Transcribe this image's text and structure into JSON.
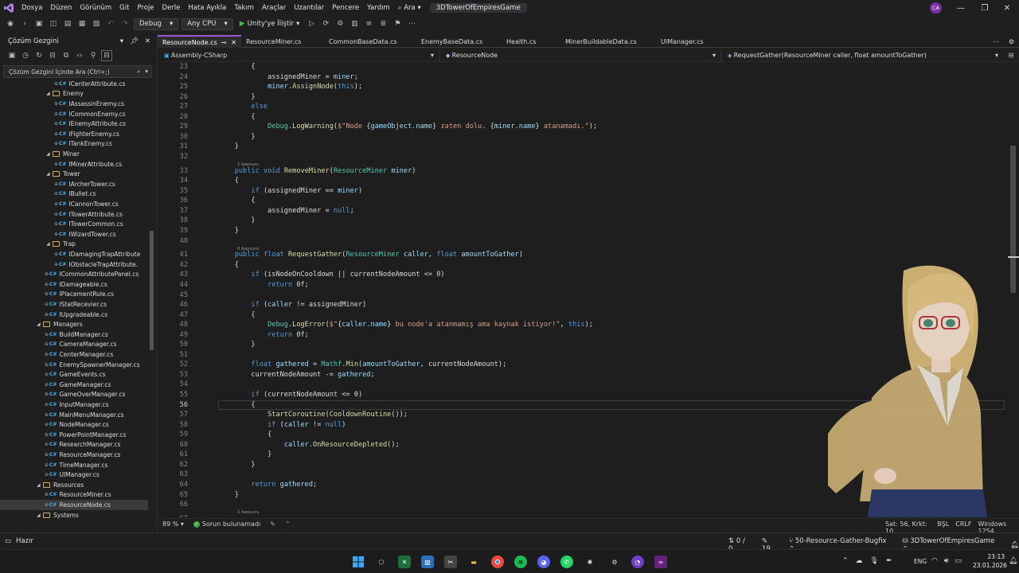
{
  "titlebar": {
    "menus": [
      "Dosya",
      "Düzen",
      "Görünüm",
      "Git",
      "Proje",
      "Derle",
      "Hata Ayıkla",
      "Takım",
      "Araçlar",
      "Uzantılar",
      "Pencere",
      "Yardım",
      "Ara"
    ],
    "solution": "3DTowerOfEmpiresGame",
    "avatar": "CA"
  },
  "toolbar": {
    "config": "Debug",
    "platform": "Any CPU",
    "run_label": "Unity'ye İliştir"
  },
  "solution_explorer": {
    "title": "Çözüm Gezgini",
    "search_placeholder": "Çözüm Gezgini İçinde Ara (Ctrl+;)",
    "tree": [
      {
        "label": "ICenterAttribute.cs",
        "type": "file",
        "indent": 5
      },
      {
        "label": "Enemy",
        "type": "folder",
        "indent": 4
      },
      {
        "label": "IAssassinEnemy.cs",
        "type": "file",
        "indent": 5
      },
      {
        "label": "ICommonEnemy.cs",
        "type": "file",
        "indent": 5
      },
      {
        "label": "IEnemyAttribute.cs",
        "type": "file",
        "indent": 5
      },
      {
        "label": "IFighterEnemy.cs",
        "type": "file",
        "indent": 5
      },
      {
        "label": "ITankEnemy.cs",
        "type": "file",
        "indent": 5
      },
      {
        "label": "Miner",
        "type": "folder",
        "indent": 4
      },
      {
        "label": "IMinerAttribute.cs",
        "type": "file",
        "indent": 5
      },
      {
        "label": "Tower",
        "type": "folder",
        "indent": 4
      },
      {
        "label": "IArcherTower.cs",
        "type": "file",
        "indent": 5
      },
      {
        "label": "IBullet.cs",
        "type": "file",
        "indent": 5
      },
      {
        "label": "ICannonTower.cs",
        "type": "file",
        "indent": 5
      },
      {
        "label": "ITowerAttribute.cs",
        "type": "file",
        "indent": 5
      },
      {
        "label": "ITowerCommon.cs",
        "type": "file",
        "indent": 5
      },
      {
        "label": "IWizardTower.cs",
        "type": "file",
        "indent": 5
      },
      {
        "label": "Trap",
        "type": "folder",
        "indent": 4
      },
      {
        "label": "IDamagingTrapAttribute",
        "type": "file",
        "indent": 5
      },
      {
        "label": "IObstacleTrapAttribute.",
        "type": "file",
        "indent": 5
      },
      {
        "label": "ICommonAttributePanel.cs",
        "type": "file",
        "indent": 4
      },
      {
        "label": "IDamageable.cs",
        "type": "file",
        "indent": 4
      },
      {
        "label": "IPlacementRule.cs",
        "type": "file",
        "indent": 4
      },
      {
        "label": "IStatRecevier.cs",
        "type": "file",
        "indent": 4
      },
      {
        "label": "IUpgradeable.cs",
        "type": "file",
        "indent": 4
      },
      {
        "label": "Managers",
        "type": "folder",
        "indent": 3
      },
      {
        "label": "BuildManager.cs",
        "type": "file",
        "indent": 4
      },
      {
        "label": "CameraManager.cs",
        "type": "file",
        "indent": 4
      },
      {
        "label": "CenterManager.cs",
        "type": "file",
        "indent": 4
      },
      {
        "label": "EnemySpawnerManager.cs",
        "type": "file",
        "indent": 4
      },
      {
        "label": "GameEvents.cs",
        "type": "file",
        "indent": 4
      },
      {
        "label": "GameManager.cs",
        "type": "file",
        "indent": 4
      },
      {
        "label": "GameOverManager.cs",
        "type": "file",
        "indent": 4
      },
      {
        "label": "InputManager.cs",
        "type": "file",
        "indent": 4
      },
      {
        "label": "MainMenuManager.cs",
        "type": "file",
        "indent": 4
      },
      {
        "label": "NodeManager.cs",
        "type": "file",
        "indent": 4
      },
      {
        "label": "PowerPointManager.cs",
        "type": "file",
        "indent": 4
      },
      {
        "label": "ResearchManager.cs",
        "type": "file",
        "indent": 4
      },
      {
        "label": "ResourceManager.cs",
        "type": "file",
        "indent": 4
      },
      {
        "label": "TimeManager.cs",
        "type": "file",
        "indent": 4
      },
      {
        "label": "UIManager.cs",
        "type": "file",
        "indent": 4
      },
      {
        "label": "Resources",
        "type": "folder",
        "indent": 3
      },
      {
        "label": "ResourceMiner.cs",
        "type": "file",
        "indent": 4
      },
      {
        "label": "ResourceNode.cs",
        "type": "file",
        "indent": 4,
        "selected": true
      },
      {
        "label": "Systems",
        "type": "folder",
        "indent": 3
      }
    ]
  },
  "tabs": [
    "ResourceNode.cs",
    "ResourceMiner.cs",
    "CommonBaseData.cs",
    "EnemyBaseData.cs",
    "Health.cs",
    "MinerBuildableData.cs",
    "UIManager.cs"
  ],
  "navbar": {
    "project": "Assembly-CSharp",
    "class": "ResourceNode",
    "member": "RequestGather(ResourceMiner caller, float amountToGather)"
  },
  "editor": {
    "current_line": 56,
    "lines": [
      {
        "n": 23,
        "code": "        {"
      },
      {
        "n": 24,
        "code": "            assignedMiner = miner;"
      },
      {
        "n": 25,
        "code": "            miner.AssignNode(this);"
      },
      {
        "n": 26,
        "code": "        }"
      },
      {
        "n": 27,
        "code": "        else"
      },
      {
        "n": 28,
        "code": "        {"
      },
      {
        "n": 29,
        "code": "            Debug.LogWarning($\"Node {gameObject.name} zaten dolu. {miner.name} atanamadı.\");"
      },
      {
        "n": 30,
        "code": "        }"
      },
      {
        "n": 31,
        "code": "    }"
      },
      {
        "n": 32,
        "code": ""
      },
      {
        "n": 33,
        "code": "    public void RemoveMiner(ResourceMiner miner)",
        "hint": "1 başvuru"
      },
      {
        "n": 34,
        "code": "    {"
      },
      {
        "n": 35,
        "code": "        if (assignedMiner == miner)"
      },
      {
        "n": 36,
        "code": "        {"
      },
      {
        "n": 37,
        "code": "            assignedMiner = null;"
      },
      {
        "n": 38,
        "code": "        }"
      },
      {
        "n": 39,
        "code": "    }"
      },
      {
        "n": 40,
        "code": ""
      },
      {
        "n": 41,
        "code": "    public float RequestGather(ResourceMiner caller, float amountToGather)",
        "hint": "0 başvuru"
      },
      {
        "n": 42,
        "code": "    {"
      },
      {
        "n": 43,
        "code": "        if (isNodeOnCooldown || currentNodeAmount <= 0)"
      },
      {
        "n": 44,
        "code": "            return 0f;"
      },
      {
        "n": 45,
        "code": ""
      },
      {
        "n": 46,
        "code": "        if (caller != assignedMiner)"
      },
      {
        "n": 47,
        "code": "        {"
      },
      {
        "n": 48,
        "code": "            Debug.LogError($\"{caller.name} bu node'a atanmamış ama kaynak istiyor!\", this);"
      },
      {
        "n": 49,
        "code": "            return 0f;"
      },
      {
        "n": 50,
        "code": "        }"
      },
      {
        "n": 51,
        "code": ""
      },
      {
        "n": 52,
        "code": "        float gathered = Mathf.Min(amountToGather, currentNodeAmount);"
      },
      {
        "n": 53,
        "code": "        currentNodeAmount -= gathered;"
      },
      {
        "n": 54,
        "code": ""
      },
      {
        "n": 55,
        "code": "        if (currentNodeAmount <= 0)"
      },
      {
        "n": 56,
        "code": "        {"
      },
      {
        "n": 57,
        "code": "            StartCoroutine(CooldownRoutine());"
      },
      {
        "n": 58,
        "code": "            if (caller != null)"
      },
      {
        "n": 59,
        "code": "            {"
      },
      {
        "n": 60,
        "code": "                caller.OnResourceDepleted();"
      },
      {
        "n": 61,
        "code": "            }"
      },
      {
        "n": 62,
        "code": "        }"
      },
      {
        "n": 63,
        "code": ""
      },
      {
        "n": 64,
        "code": "        return gathered;"
      },
      {
        "n": 65,
        "code": "    }"
      },
      {
        "n": 66,
        "code": ""
      },
      {
        "n": 67,
        "code": "",
        "hint": "1 başvuru"
      }
    ]
  },
  "editor_status": {
    "zoom": "89 %",
    "issues": "Sorun bulunamadı",
    "position": "Sat: 56, Krkt: 10",
    "indent": "BŞL",
    "line_ending": "CRLF",
    "encoding": "Windows 1254"
  },
  "statusbar": {
    "ready": "Hazır",
    "git_changes": "0 / 0",
    "edits": "19",
    "branch": "50-Resource-Gather-Bugfix",
    "repo": "3DTowerOfEmpiresGame"
  },
  "taskbar": {
    "lang": "ENG",
    "time": "23:13",
    "date": "23.01.2026"
  },
  "colors": {
    "accent": "#9b59d0",
    "keyword": "#569cd6",
    "type": "#4ec9b0",
    "method": "#dcdcaa",
    "string": "#d69d85",
    "variable": "#9cdcfe"
  }
}
